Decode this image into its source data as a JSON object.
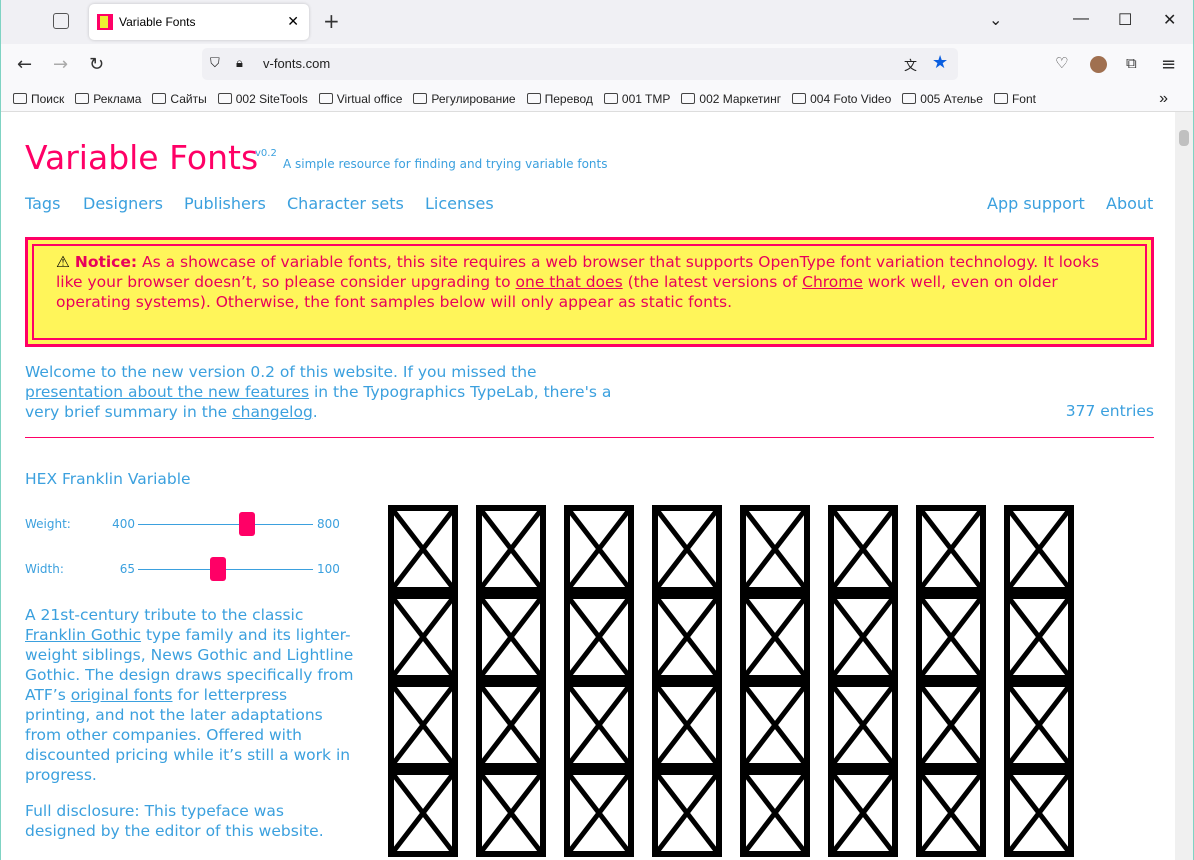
{
  "browser": {
    "tab_title": "Variable Fonts",
    "url": "v-fonts.com",
    "bookmarks": [
      "Поиск",
      "Реклама",
      "Сайты",
      "002 SiteTools",
      "Virtual office",
      "Регулирование",
      "Перевод",
      "001 TMP",
      "002 Маркетинг",
      "004 Foto Video",
      "005 Ателье",
      "Font"
    ]
  },
  "site": {
    "title": "Variable Fonts",
    "version": "v0.2",
    "tagline": "A simple resource for finding and trying variable fonts",
    "nav": [
      "Tags",
      "Designers",
      "Publishers",
      "Character sets",
      "Licenses"
    ],
    "nav_right": [
      "App support",
      "About"
    ]
  },
  "notice": {
    "label": "Notice:",
    "t1": " As a showcase of variable fonts, this site requires a web browser that supports OpenType font variation technology. It looks like your browser doesn’t, so please consider upgrading to ",
    "link1": "one that does",
    "t2": " (the latest versions of ",
    "link2": "Chrome",
    "t3": " work well, even on older operating systems). Otherwise, the font samples below will only appear as static fonts."
  },
  "welcome": {
    "t1": "Welcome to the new version 0.2 of this website. If you missed the ",
    "link1": "presentation about the new features",
    "t2": " in the Typographics TypeLab, there's a very brief summary in the ",
    "link2": "changelog",
    "t3": "."
  },
  "entries": "377 entries",
  "font": {
    "name": "HEX Franklin Variable",
    "axes": [
      {
        "label": "Weight:",
        "min": "400",
        "max": "800",
        "value": 650
      },
      {
        "label": "Width:",
        "min": "65",
        "max": "100",
        "value": 81
      }
    ],
    "d1": "A 21st-century tribute to the classic ",
    "l1": "Franklin Gothic",
    "d2": " type family and its lighter-weight siblings, News Gothic and Lightline Gothic. The design draws specifically from ATF’s ",
    "l2": "original fonts",
    "d3": " for letterpress printing, and not the later adaptations from other companies. Offered with discounted pricing while it’s still a work in progress.",
    "disclosure": "Full disclosure: This typeface was designed by the editor of this website."
  },
  "colors": {
    "accent": "#ff0066",
    "link": "#3ba0de",
    "notice_bg": "#fff55a"
  }
}
